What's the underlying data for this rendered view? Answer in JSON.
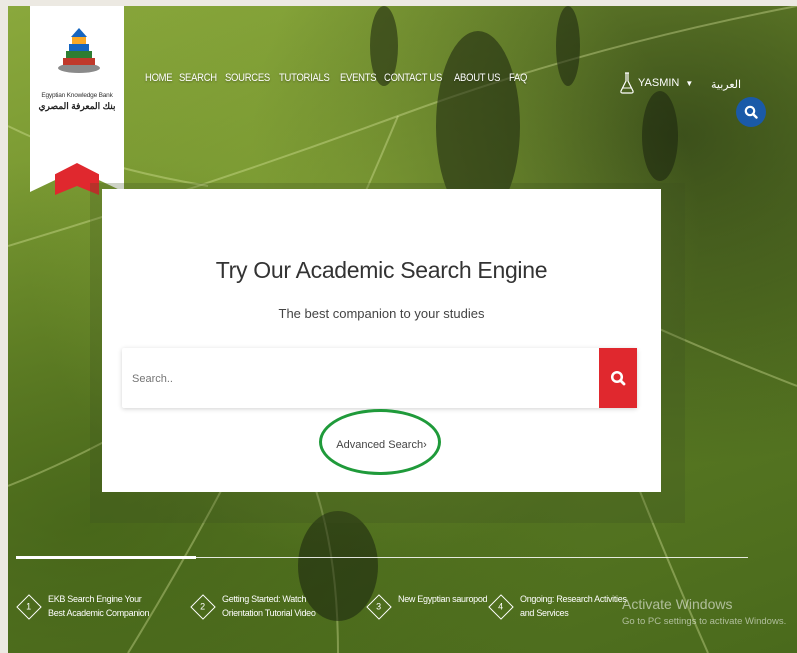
{
  "logo": {
    "name_en": "Egyptian Knowledge Bank",
    "name_ar": "بنك المعرفة المصري",
    "icon": "books-stack-icon"
  },
  "nav": {
    "items": [
      "HOME",
      "SEARCH",
      "SOURCES",
      "TUTORIALS",
      "EVENTS",
      "CONTACT US",
      "ABOUT US",
      "FAQ"
    ]
  },
  "user": {
    "name": "YASMIN",
    "icon": "flask-icon"
  },
  "language": {
    "label": "العربية"
  },
  "hero": {
    "title": "Try Our Academic Search Engine",
    "subtitle": "The best companion to your studies",
    "search_placeholder": "Search..",
    "advanced_link": "Advanced Search›"
  },
  "news": [
    {
      "number": "1",
      "text": "EKB Search Engine Your Best Academic Companion"
    },
    {
      "number": "2",
      "text": "Getting Started: Watch Orientation Tutorial Video"
    },
    {
      "number": "3",
      "text": "New Egyptian sauropod"
    },
    {
      "number": "4",
      "text": "Ongoing: Research Activities and Services"
    }
  ],
  "watermark": {
    "title": "Activate Windows",
    "subtitle": "Go to PC settings to activate Windows."
  },
  "colors": {
    "accent_red": "#e0282e",
    "accent_blue": "#1a5aa8",
    "highlight_green": "#1f9a3a"
  }
}
